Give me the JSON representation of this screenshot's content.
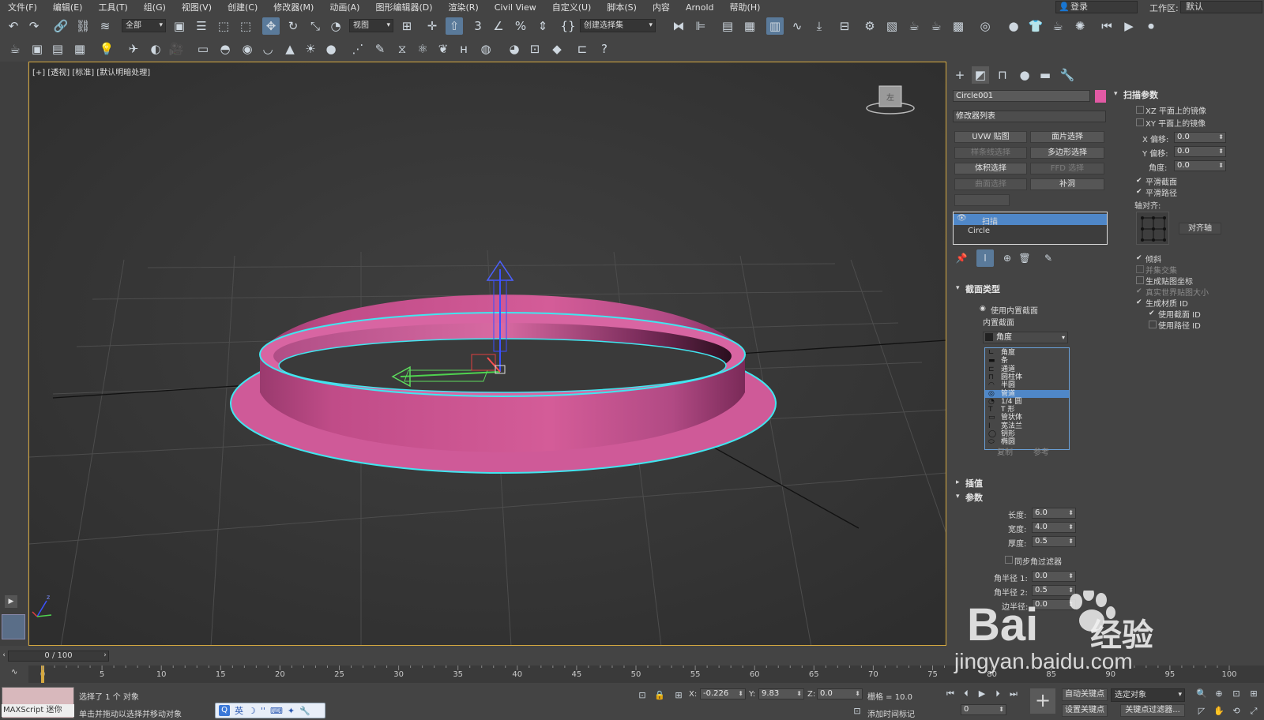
{
  "menubar": {
    "items": [
      "文件(F)",
      "编辑(E)",
      "工具(T)",
      "组(G)",
      "视图(V)",
      "创建(C)",
      "修改器(M)",
      "动画(A)",
      "图形编辑器(D)",
      "渲染(R)",
      "Civil View",
      "自定义(U)",
      "脚本(S)",
      "内容",
      "Arnold",
      "帮助(H)"
    ],
    "login_label": "登录",
    "workspace_label": "工作区:",
    "workspace_value": "默认"
  },
  "toolbar": {
    "selection_filter": "全部",
    "ref_coord": "视图",
    "named_selection": "创建选择集"
  },
  "viewport": {
    "label": "[+] [透视] [标准] [默认明暗处理]",
    "object_color": "#d9609e",
    "selection_outline": "#41e6f0",
    "border_color": "#d6a940"
  },
  "command_panel": {
    "object_name": "Circle001",
    "object_color": "#e25aa4",
    "modifier_list": "修改器列表",
    "modifier_buttons": [
      {
        "label": "UVW 贴图",
        "enabled": true
      },
      {
        "label": "面片选择",
        "enabled": true
      },
      {
        "label": "样条线选择",
        "enabled": false
      },
      {
        "label": "多边形选择",
        "enabled": true
      },
      {
        "label": "体积选择",
        "enabled": true
      },
      {
        "label": "FFD 选择",
        "enabled": false
      },
      {
        "label": "曲面选择",
        "enabled": false
      },
      {
        "label": "补洞",
        "enabled": true
      }
    ],
    "stack": [
      "扫描",
      "Circle"
    ],
    "section_type": {
      "title": "截面类型",
      "use_builtin": "使用内置截面",
      "builtin_group": "内置截面",
      "selected": "角度",
      "list": [
        "角度",
        "条",
        "通道",
        "圆柱体",
        "半圆",
        "管道",
        "1/4 圆",
        "T 形",
        "管状体",
        "宽法兰",
        "钥形",
        "椭圆"
      ],
      "highlighted_index": 5,
      "hidden_left": "复制",
      "hidden_right": "参考"
    },
    "interpolation_title": "插值",
    "params": {
      "title": "参数",
      "length_label": "长度:",
      "length": "6.0",
      "width_label": "宽度:",
      "width": "4.0",
      "thickness_label": "厚度:",
      "thickness": "0.5",
      "sync_filter": "同步角过滤器",
      "corner_r1_label": "角半径 1:",
      "corner_r1": "0.0",
      "corner_r2_label": "角半径 2:",
      "corner_r2": "0.5",
      "edge_r_label": "边半径:",
      "edge_r": "0.0"
    }
  },
  "sweep_params": {
    "title": "扫描参数",
    "mirror_xz": "XZ 平面上的镜像",
    "mirror_xy": "XY 平面上的镜像",
    "x_offset_label": "X 偏移:",
    "x_offset": "0.0",
    "y_offset_label": "Y 偏移:",
    "y_offset": "0.0",
    "angle_label": "角度:",
    "angle": "0.0",
    "smooth_section": "平滑截面",
    "smooth_path": "平滑路径",
    "pivot_align": "轴对齐:",
    "align_pivot_btn": "对齐轴",
    "banking": "倾斜",
    "union": "并集交集",
    "gen_mapping": "生成贴图坐标",
    "real_world": "真实世界贴图大小",
    "gen_mat_id": "生成材质 ID",
    "use_section_id": "使用截面 ID",
    "use_path_id": "使用路径 ID"
  },
  "timeline": {
    "slider": "0 / 100",
    "ticks": [
      0,
      5,
      10,
      15,
      20,
      25,
      30,
      35,
      40,
      45,
      50,
      55,
      60,
      65,
      70,
      75,
      80,
      85,
      90,
      95,
      100
    ]
  },
  "status": {
    "maxscript": "MAXScript 迷你",
    "selected": "选择了 1 个 对象",
    "hint": "单击并拖动以选择并移动对象",
    "x_label": "X:",
    "x": "-0.226",
    "y_label": "Y:",
    "y": "9.83",
    "z_label": "Z:",
    "z": "0.0",
    "grid": "栅格 = 10.0",
    "add_time_tag": "添加时间标记",
    "auto_key": "自动关键点",
    "selected_set": "选定对象",
    "set_key": "设置关键点",
    "key_filters": "关键点过滤器...",
    "frame": "0"
  },
  "ime": {
    "lang": "英"
  },
  "watermark": {
    "text": "Bai",
    "cn": "经验",
    "url": "jingyan.baidu.com"
  }
}
